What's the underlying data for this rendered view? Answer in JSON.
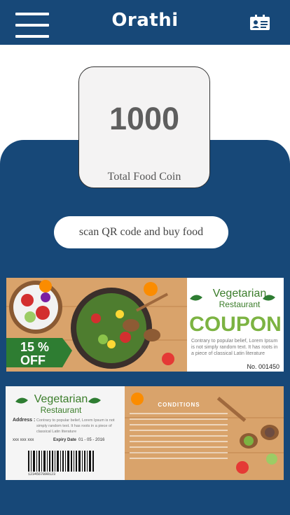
{
  "header": {
    "title": "Orathi",
    "menu_icon": "hamburger-menu-icon",
    "contact_icon": "contact-card-icon"
  },
  "wallet": {
    "coin_value": "1000",
    "coin_label": "Total Food Coin"
  },
  "actions": {
    "scan_label": "scan QR code and buy food"
  },
  "coupon1": {
    "brand_line1": "Vegetarian",
    "brand_line2": "Restaurant",
    "headline": "COUPON",
    "discount": "15 %",
    "discount_word": "OFF",
    "body": "Contrary to popular belief, Lorem Ipsum is not simply random text. It has roots in a piece of classical Latin literature",
    "number": "No. 001450"
  },
  "coupon2": {
    "brand_line1": "Vegetarian",
    "brand_line2": "Restaurant",
    "address_label": "Address :",
    "address_text": "Contrary to popular belief, Lorem Ipsum is not simply random text. It has roots in a piece of classical Latin literature",
    "phone": "xxx xxx xxx",
    "expiry_label": "Expiry Date",
    "expiry_value": "01 - 05 - 2016",
    "conditions_title": "CONDITIONS",
    "barcode_number": "1234567890123"
  },
  "colors": {
    "primary": "#174878",
    "card_bg": "#f4f3f3",
    "coupon_green": "#7cb342",
    "wood": "#d9a36b"
  }
}
